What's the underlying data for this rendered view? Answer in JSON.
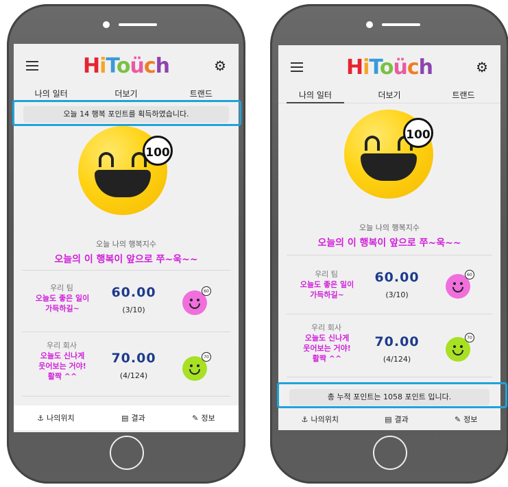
{
  "app": {
    "logo_letters": [
      "H",
      "i",
      "T",
      "o",
      "ü",
      "c",
      "h"
    ],
    "logo_colors": [
      "#e52531",
      "#f5a623",
      "#3a9ad9",
      "#7ac143",
      "#e85ba2",
      "#f07e26",
      "#8e44ad"
    ]
  },
  "tabs": [
    "나의 일터",
    "더보기",
    "트랜드"
  ],
  "left": {
    "notice": "오늘 14 행복 포인트를 획득하였습니다.",
    "score_badge": "100",
    "today_label": "오늘 나의 행복지수",
    "today_message": "오늘의 이 행복이 앞으로 쭈~욱~~",
    "rows": [
      {
        "name": "우리 팀",
        "message_lines": [
          "오늘도 좋은 일이",
          "가득하길~"
        ],
        "score": "60.00",
        "count": "(3/10)",
        "badge": "60",
        "face_color": "#f06fdc"
      },
      {
        "name": "우리 회사",
        "message_lines": [
          "오늘도 신나게",
          "웃어보는 거야!",
          "활짝 ^^"
        ],
        "score": "70.00",
        "count": "(4/124)",
        "badge": "70",
        "face_color": "#a8e024"
      }
    ]
  },
  "right": {
    "score_badge": "100",
    "today_label": "오늘 나의 행복지수",
    "today_message": "오늘의 이 행복이 앞으로 쭈~욱~~",
    "rows": [
      {
        "name": "우리 팀",
        "message_lines": [
          "오늘도 좋은 일이",
          "가득하길~"
        ],
        "score": "60.00",
        "count": "(3/10)",
        "badge": "60",
        "face_color": "#f06fdc"
      },
      {
        "name": "우리 회사",
        "message_lines": [
          "오늘도 신나게",
          "웃어보는 거야!",
          "활짝 ^^"
        ],
        "score": "70.00",
        "count": "(4/124)",
        "badge": "70",
        "face_color": "#a8e024"
      }
    ],
    "notice": "총 누적 포인트는 1058 포인트 입니다."
  },
  "bottom_nav": [
    {
      "label": "나의위치",
      "icon": "location-icon"
    },
    {
      "label": "결과",
      "icon": "results-icon"
    },
    {
      "label": "정보",
      "icon": "pencil-icon"
    }
  ],
  "highlight_color": "#1fa3d9"
}
